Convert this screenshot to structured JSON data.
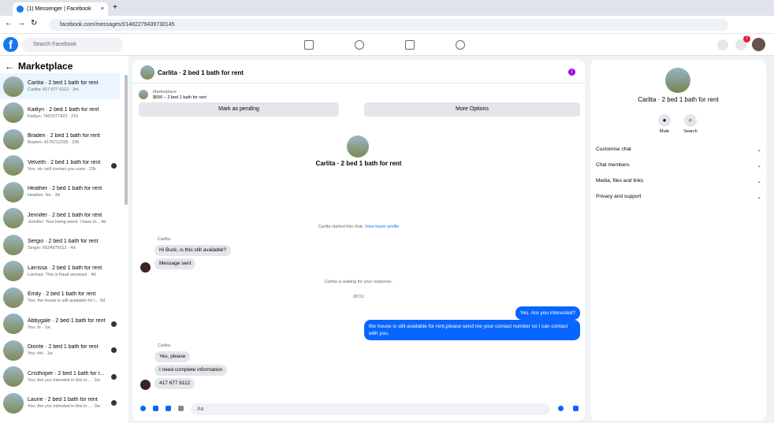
{
  "browser": {
    "tab_title": "(1) Messenger | Facebook",
    "url": "facebook.com/messages/t/1482279439730145"
  },
  "nav": {
    "search_placeholder": "Search Facebook",
    "notification_count": "7"
  },
  "sidebar": {
    "title": "Marketplace",
    "conversations": [
      {
        "name": "Carlita · 2 bed 1 bath for rent",
        "preview": "Carlita: 417 677 6112 · 2m"
      },
      {
        "name": "Kaitlyn · 2 bed 1 bath for rent",
        "preview": "Kaitlyn: 7407077423 · 21h"
      },
      {
        "name": "Braden · 2 bed 1 bath for rent",
        "preview": "Braden: 4176712155 · 23h"
      },
      {
        "name": "Velveth · 2 bed 1 bath for rent",
        "preview": "You: ok i will contact you soon · 23h"
      },
      {
        "name": "Heather · 2 bed 1 bath for rent",
        "preview": "Heather: No · 3d"
      },
      {
        "name": "Jennifer · 2 bed 1 bath for rent",
        "preview": "Jennifer: Your being weird. I have lo... 4d"
      },
      {
        "name": "Sergio · 2 bed 1 bath for rent",
        "preview": "Sergio: 6624970012 · 4d"
      },
      {
        "name": "Larrissa · 2 bed 1 bath for rent",
        "preview": "Larrissa: This is fraud anyways · 4d"
      },
      {
        "name": "Emily · 2 bed 1 bath for rent",
        "preview": "You: the house is still available for r... 6d"
      },
      {
        "name": "Abbygale · 2 bed 1 bath for rent",
        "preview": "You: hi · 1w"
      },
      {
        "name": "Dionte · 2 bed 1 bath for rent",
        "preview": "You: hhi · 1w"
      },
      {
        "name": "Cristhoper · 2 bed 1 bath for r...",
        "preview": "You: Are you intrested in this lo... · 2w"
      },
      {
        "name": "Laurie · 2 bed 1 bath for rent",
        "preview": "You: Are you intrested in this lo... · 3w"
      }
    ]
  },
  "chat": {
    "title": "Carlita · 2 bed 1 bath for rent",
    "listing_label": "Marketplace",
    "listing_price": "$650 – 2 bed 1 bath for rent",
    "buttons": [
      "Mark as pending",
      "More Options"
    ],
    "started": "Carlita started this chat.",
    "buyer_link": "View buyer profile",
    "waiting": "Carlita is waiting for your response.",
    "time": "08:51",
    "composer_placeholder": "Aa"
  },
  "messages": [
    {
      "label": "Carlita",
      "text": "Hi Buck, is this still available?"
    },
    {
      "text": "Message sent"
    },
    {
      "text": "Yes. Are you interested?"
    },
    {
      "text": "the house is still available for rent,please send me your contact number so I can contact with you."
    },
    {
      "label": "Carlita",
      "text": "Yes, please"
    },
    {
      "text": "I need complete information"
    },
    {
      "text": "417 677 6112"
    }
  ],
  "right": {
    "title": "Carlita · 2 bed 1 bath for rent",
    "actions": [
      "Mute",
      "Search"
    ],
    "sections": [
      "Customise chat",
      "Chat members",
      "Media, files and links",
      "Privacy and support"
    ]
  }
}
